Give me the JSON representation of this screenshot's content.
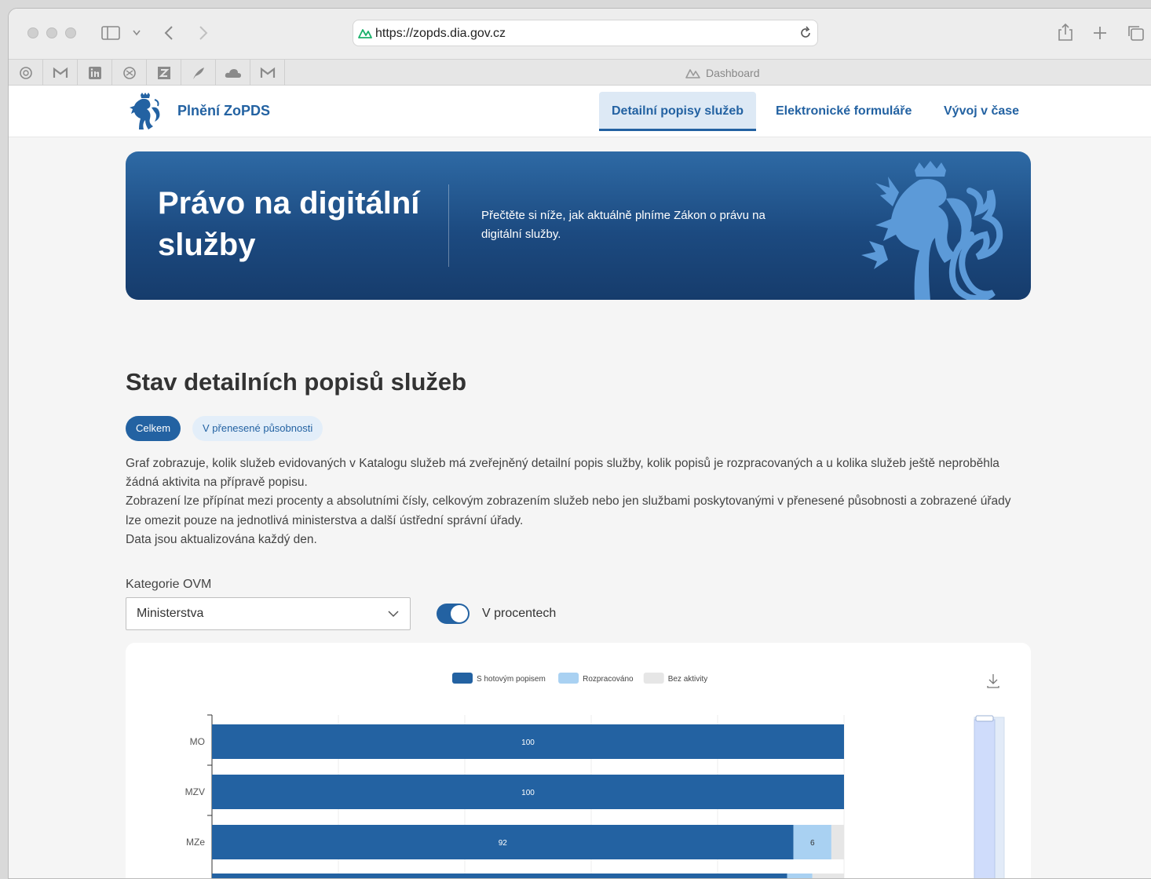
{
  "browser": {
    "url": "https://zopds.dia.gov.cz",
    "tab_title": "Dashboard"
  },
  "nav": {
    "brand": "Plnění ZoPDS",
    "items": [
      {
        "label": "Detailní popisy služeb",
        "active": true
      },
      {
        "label": "Elektronické formuláře",
        "active": false
      },
      {
        "label": "Vývoj v čase",
        "active": false
      }
    ]
  },
  "hero": {
    "title": "Právo na digitální služby",
    "text": "Přečtěte si níže, jak aktuálně plníme Zákon o právu na digitální služby."
  },
  "section": {
    "title": "Stav detailních popisů služeb",
    "filter_all": "Celkem",
    "filter_delegated": "V přenesené působnosti",
    "desc_1": "Graf zobrazuje, kolik služeb evidovaných v Katalogu služeb má zveřejněný detailní popis služby, kolik popisů je rozpracovaných a u kolika služeb ještě neproběhla žádná aktivita na přípravě popisu.",
    "desc_2": "Zobrazení lze přípínat mezi procenty a absolutními čísly, celkovým zobrazením služeb nebo jen službami poskytovanými v přenesené působnosti a zobrazené úřady lze omezit pouze na jednotlivá ministerstva a další ústřední správní úřady.",
    "desc_3": "Data jsou aktualizována každý den."
  },
  "controls": {
    "ovm_label": "Kategorie OVM",
    "ovm_value": "Ministerstva",
    "percent_label": "V procentech",
    "percent_on": true
  },
  "colors": {
    "primary": "#2362a2",
    "in_progress": "#a9d1f2",
    "no_activity": "#e6e6e6"
  },
  "chart_data": {
    "type": "bar",
    "orientation": "horizontal",
    "stacked": true,
    "categories": [
      "MO",
      "MZV",
      "MZe"
    ],
    "series": [
      {
        "name": "S hotovým popisem",
        "values": [
          100,
          100,
          92
        ]
      },
      {
        "name": "Rozpracováno",
        "values": [
          0,
          0,
          6
        ]
      },
      {
        "name": "Bez aktivity",
        "values": [
          0,
          0,
          2
        ]
      }
    ],
    "xlim": [
      0,
      100
    ],
    "legend": "top-center",
    "grid": true
  }
}
